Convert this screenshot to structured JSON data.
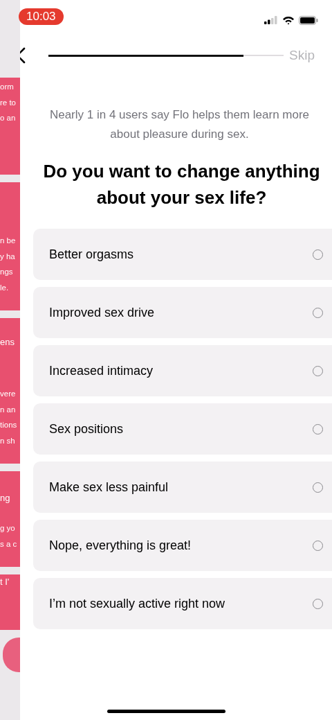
{
  "status_bar": {
    "time": "10:03"
  },
  "background_cards": [
    {
      "lines": [
        "orm",
        "re to",
        "o an"
      ]
    },
    {
      "lines": [
        "n be",
        "y ha",
        "ngs",
        "le."
      ]
    },
    {
      "title": "ens",
      "lines": [
        "vere",
        "n an",
        "tions",
        "n sh"
      ]
    },
    {
      "title": "ng",
      "lines": [
        "g yo",
        "s a c"
      ]
    },
    {
      "title": "t I'"
    }
  ],
  "header": {
    "progress": {
      "level": 0.83
    },
    "skip": "Skip"
  },
  "subtitle": "Nearly 1 in 4 users say Flo helps them learn more about pleasure during sex.",
  "question": "Do you want to change anything about your sex life?",
  "options": [
    {
      "label": "Better orgasms",
      "selected": false
    },
    {
      "label": "Improved sex drive",
      "selected": false
    },
    {
      "label": "Increased intimacy",
      "selected": false
    },
    {
      "label": "Sex positions",
      "selected": false
    },
    {
      "label": "Make sex less painful",
      "selected": false
    },
    {
      "label": "Nope, everything is great!",
      "selected": false
    },
    {
      "label": "I’m not sexually active right now",
      "selected": false
    }
  ]
}
